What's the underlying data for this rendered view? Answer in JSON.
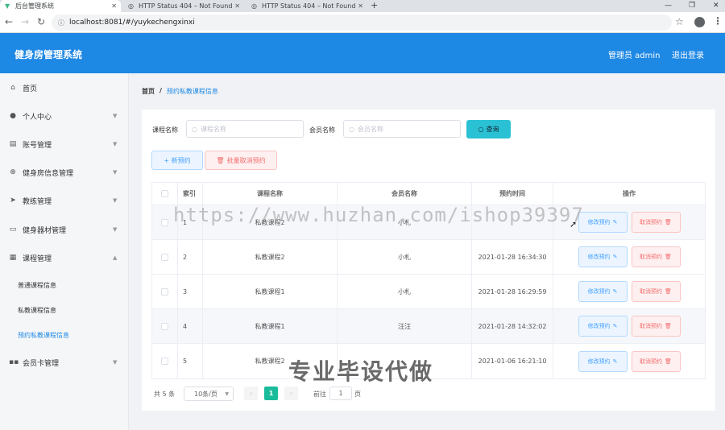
{
  "browser": {
    "tabs": [
      {
        "title": "后台管理系统",
        "active": true
      },
      {
        "title": "HTTP Status 404 – Not Found",
        "active": false
      },
      {
        "title": "HTTP Status 404 – Not Found",
        "active": false
      }
    ],
    "url": "localhost:8081/#/yuykechengxinxi"
  },
  "header": {
    "title": "健身房管理系统",
    "admin_label": "管理员 admin",
    "logout_label": "退出登录",
    "color": "#1e88e5"
  },
  "sidebar": {
    "items": [
      {
        "label": "首页",
        "icon": "home-icon"
      },
      {
        "label": "个人中心",
        "icon": "user-icon"
      },
      {
        "label": "账号管理",
        "icon": "briefcase-icon"
      },
      {
        "label": "健身房信息管理",
        "icon": "target-icon"
      },
      {
        "label": "教练管理",
        "icon": "send-icon"
      },
      {
        "label": "健身器材管理",
        "icon": "list-icon"
      },
      {
        "label": "课程管理",
        "icon": "grid-icon"
      },
      {
        "label": "会员卡管理",
        "icon": "apps-icon"
      }
    ],
    "sub_items": [
      {
        "label": "普通课程信息",
        "active": false
      },
      {
        "label": "私教课程信息",
        "active": false
      },
      {
        "label": "预约私教课程信息",
        "active": true
      }
    ]
  },
  "breadcrumb": {
    "home": "首页",
    "separator": "/",
    "current": "预约私教课程信息"
  },
  "search": {
    "course_label": "课程名称",
    "course_placeholder": "课程名称",
    "member_label": "会员名称",
    "member_placeholder": "会员名称",
    "query_label": "查询"
  },
  "actions": {
    "add_label": "+ 新预约",
    "batch_cancel_label": "批量取消预约"
  },
  "table": {
    "columns": [
      "索引",
      "课程名称",
      "会员名称",
      "预约时间",
      "操作"
    ],
    "rows": [
      {
        "index": "1",
        "course": "私教课程2",
        "member": "小札",
        "time": ""
      },
      {
        "index": "2",
        "course": "私教课程2",
        "member": "小札",
        "time": "2021-01-28 16:34:30"
      },
      {
        "index": "3",
        "course": "私教课程1",
        "member": "小札",
        "time": "2021-01-28 16:29:59"
      },
      {
        "index": "4",
        "course": "私教课程1",
        "member": "汪汪",
        "time": "2021-01-28 14:32:02"
      },
      {
        "index": "5",
        "course": "私教课程2",
        "member": "",
        "time": "2021-01-06 16:21:10"
      }
    ],
    "edit_label": "修改预约",
    "cancel_label": "取消预约"
  },
  "pagination": {
    "total": "共 5 条",
    "page_size": "10条/页",
    "current_page": "1",
    "goto_label": "前往",
    "goto_value": "1",
    "page_suffix": "页"
  },
  "overlay": {
    "watermark": "https://www.huzhan.com/ishop39397",
    "stamp": "专业毕设代做"
  }
}
